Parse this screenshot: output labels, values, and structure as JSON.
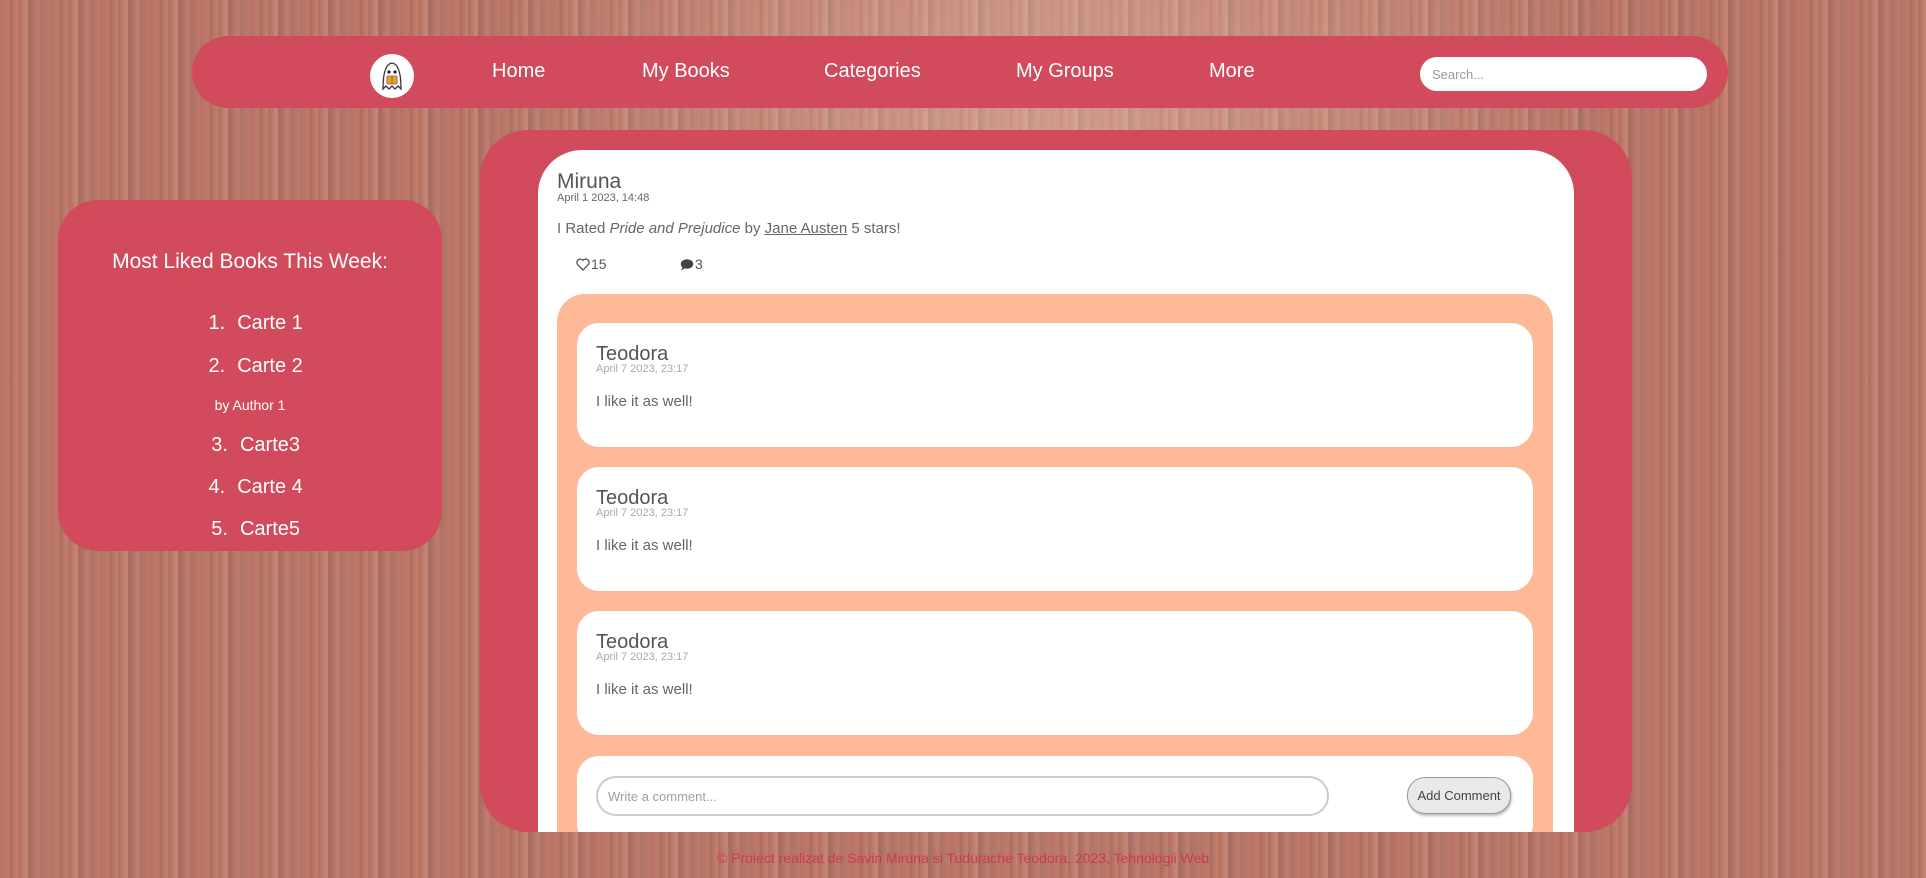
{
  "nav": {
    "items": [
      "Home",
      "My Books",
      "Categories",
      "My Groups",
      "More"
    ],
    "search_placeholder": "Search...",
    "logo_icon": "ghost-reading-icon"
  },
  "sidebar": {
    "title": "Most Liked Books This Week:",
    "books": [
      {
        "num": "1.",
        "title": "Carte 1"
      },
      {
        "num": "2.",
        "title": "Carte 2",
        "author": "by Author 1"
      },
      {
        "num": "3.",
        "title": "Carte3"
      },
      {
        "num": "4.",
        "title": "Carte 4"
      },
      {
        "num": "5.",
        "title": "Carte5"
      }
    ]
  },
  "post": {
    "author": "Miruna",
    "time": "April 1 2023, 14:48",
    "text_prefix": "I Rated ",
    "book_title": "Pride and Prejudice",
    "text_by": " by ",
    "book_author": "Jane Austen",
    "text_suffix": " 5 stars!",
    "likes": "15",
    "comments_count": "3",
    "like_icon": "heart-outline-icon",
    "comment_icon": "speech-bubble-icon"
  },
  "comments": [
    {
      "author": "Teodora",
      "time": "April 7 2023, 23:17",
      "text": "I like it as well!"
    },
    {
      "author": "Teodora",
      "time": "April 7 2023, 23:17",
      "text": "I like it as well!"
    },
    {
      "author": "Teodora",
      "time": "April 7 2023, 23:17",
      "text": "I like it as well!"
    }
  ],
  "comment_form": {
    "placeholder": "Write a comment...",
    "button": "Add Comment"
  },
  "footer": "© Proiect realizat de Savin Miruna si Tudurache Teodora, 2023, Tehnologii Web",
  "colors": {
    "primary": "#d14b5d",
    "comments_bg": "#feb997",
    "footer_text": "#cc3a52"
  }
}
